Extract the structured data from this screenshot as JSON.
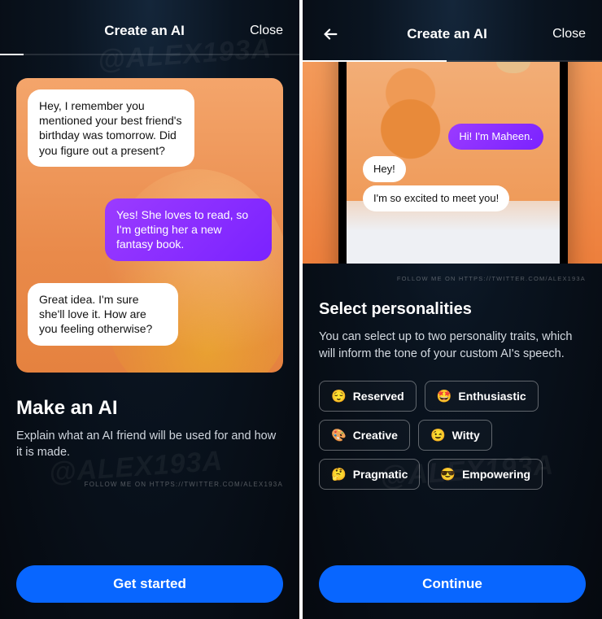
{
  "watermark": "@ALEX193A",
  "follow_text": "FOLLOW ME ON HTTPS://TWITTER.COM/ALEX193A",
  "screen1": {
    "header": {
      "title": "Create an AI",
      "close": "Close"
    },
    "progress_pct": 8,
    "chat": {
      "msg1": "Hey, I remember you mentioned your best friend's birthday was tomorrow. Did you figure out a present?",
      "msg2": "Yes! She loves to read, so I'm getting her a new fantasy book.",
      "msg3": "Great idea. I'm sure she'll love it. How are you feeling otherwise?"
    },
    "title": "Make an AI",
    "subtitle": "Explain what an AI friend will be used for and how it is made.",
    "cta": "Get started"
  },
  "screen2": {
    "header": {
      "title": "Create an AI",
      "close": "Close"
    },
    "progress_pct": 48,
    "phone_chat": {
      "msg1": "Hi! I'm Maheen.",
      "msg2": "Hey!",
      "msg3": "I'm so excited to meet you!"
    },
    "title": "Select personalities",
    "subtitle": "You can select up to two personality traits, which will inform the tone of your custom AI's speech.",
    "chips": [
      {
        "emoji": "😌",
        "label": "Reserved"
      },
      {
        "emoji": "🤩",
        "label": "Enthusiastic"
      },
      {
        "emoji": "🎨",
        "label": "Creative"
      },
      {
        "emoji": "😉",
        "label": "Witty"
      },
      {
        "emoji": "🤔",
        "label": "Pragmatic"
      },
      {
        "emoji": "😎",
        "label": "Empowering"
      }
    ],
    "cta": "Continue"
  }
}
